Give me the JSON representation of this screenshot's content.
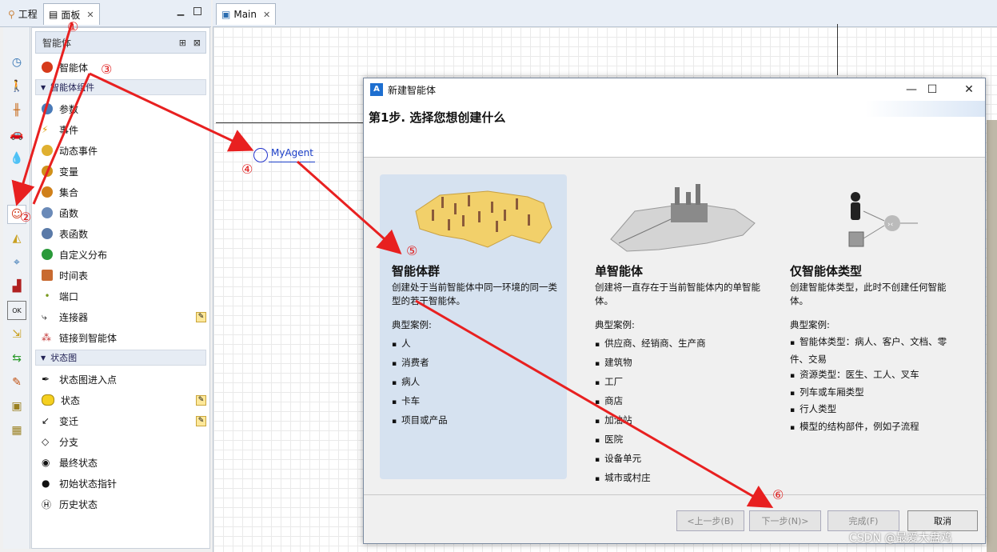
{
  "left_tabs": [
    {
      "label": "工程",
      "active": false
    },
    {
      "label": "面板",
      "active": true
    }
  ],
  "editor_tab": "Main",
  "palette": {
    "header": "智能体",
    "top_item": "智能体",
    "section1": "智能体组件",
    "items1": [
      "参数",
      "事件",
      "动态事件",
      "变量",
      "集合",
      "函数",
      "表函数",
      "自定义分布",
      "时间表",
      "端口",
      "连接器",
      "链接到智能体"
    ],
    "section2": "状态图",
    "items2": [
      "状态图进入点",
      "状态",
      "变迁",
      "分支",
      "最终状态",
      "初始状态指针",
      "历史状态"
    ]
  },
  "canvas": {
    "agent_label": "MyAgent"
  },
  "dialog": {
    "title": "新建智能体",
    "step": "第1步. 选择您想创建什么",
    "options": [
      {
        "title": "智能体群",
        "desc": "创建处于当前智能体中同一环境的同一类型的若干智能体。",
        "examples_label": "典型案例:",
        "examples": [
          "人",
          "消费者",
          "病人",
          "卡车",
          "项目或产品"
        ]
      },
      {
        "title": "单智能体",
        "desc": "创建将一直存在于当前智能体内的单智能体。",
        "examples_label": "典型案例:",
        "examples": [
          "供应商、经销商、生产商",
          "建筑物",
          "工厂",
          "商店",
          "加油站",
          "医院",
          "设备单元",
          "城市或村庄"
        ]
      },
      {
        "title": "仅智能体类型",
        "desc": "创建智能体类型，此时不创建任何智能体。",
        "examples_label": "典型案例:",
        "examples": [
          "智能体类型：病人、客户、文档、零件、交易",
          "资源类型：医生、工人、叉车",
          "列车或车厢类型",
          "行人类型",
          "模型的结构部件，例如子流程"
        ]
      }
    ],
    "buttons": {
      "back": "<上一步(B)",
      "next": "下一步(N)>",
      "finish": "完成(F)",
      "cancel": "取消"
    }
  },
  "annotations": [
    "①",
    "②",
    "③",
    "④",
    "⑤",
    "⑥"
  ],
  "watermark": "CSDN @最爱大盘鸡",
  "colors": {
    "arrow": "#e82020",
    "selection": "#d6e2f0",
    "link": "#1a3ec8"
  }
}
